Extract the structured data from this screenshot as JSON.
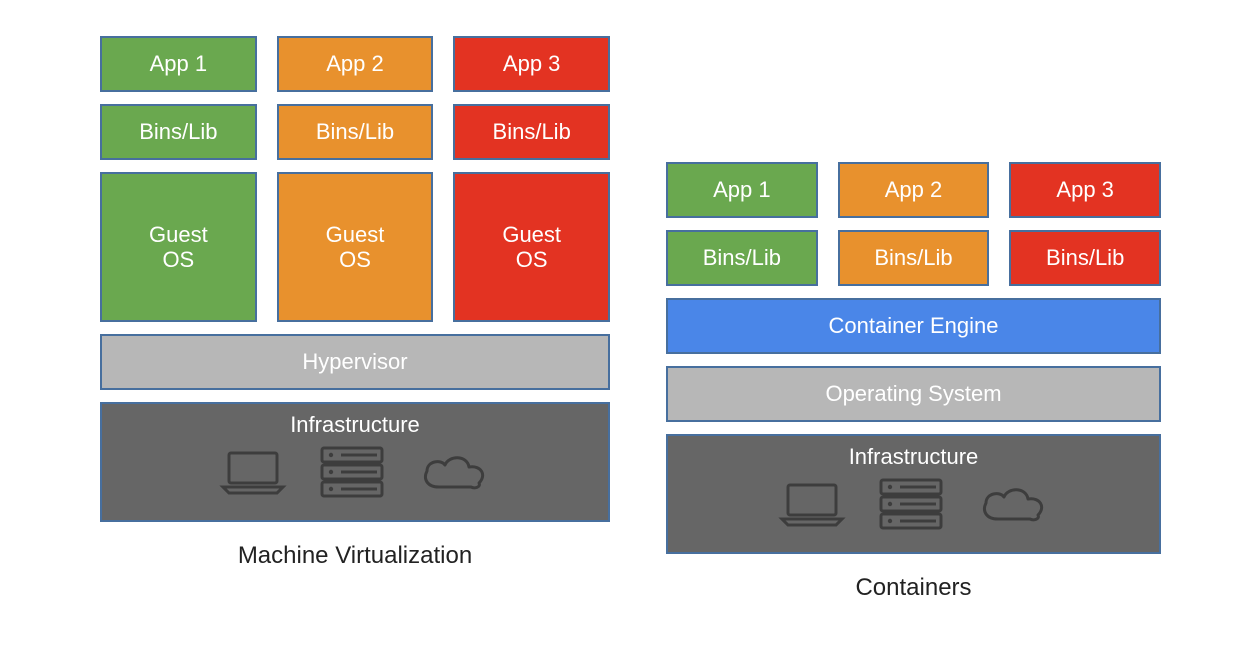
{
  "vm": {
    "apps": [
      "App 1",
      "App 2",
      "App 3"
    ],
    "binslibs": [
      "Bins/Lib",
      "Bins/Lib",
      "Bins/Lib"
    ],
    "guestos": [
      "Guest\nOS",
      "Guest\nOS",
      "Guest\nOS"
    ],
    "hypervisor": "Hypervisor",
    "infrastructure": "Infrastructure",
    "caption": "Machine Virtualization"
  },
  "ct": {
    "apps": [
      "App 1",
      "App 2",
      "App 3"
    ],
    "binslibs": [
      "Bins/Lib",
      "Bins/Lib",
      "Bins/Lib"
    ],
    "engine": "Container Engine",
    "os": "Operating System",
    "infrastructure": "Infrastructure",
    "caption": "Containers"
  },
  "colors": {
    "green": "#6aa84f",
    "orange": "#e8912d",
    "red": "#e33322",
    "blue": "#4a86e8",
    "grey": "#b7b7b7",
    "dark": "#666666",
    "border": "#476f9e"
  }
}
